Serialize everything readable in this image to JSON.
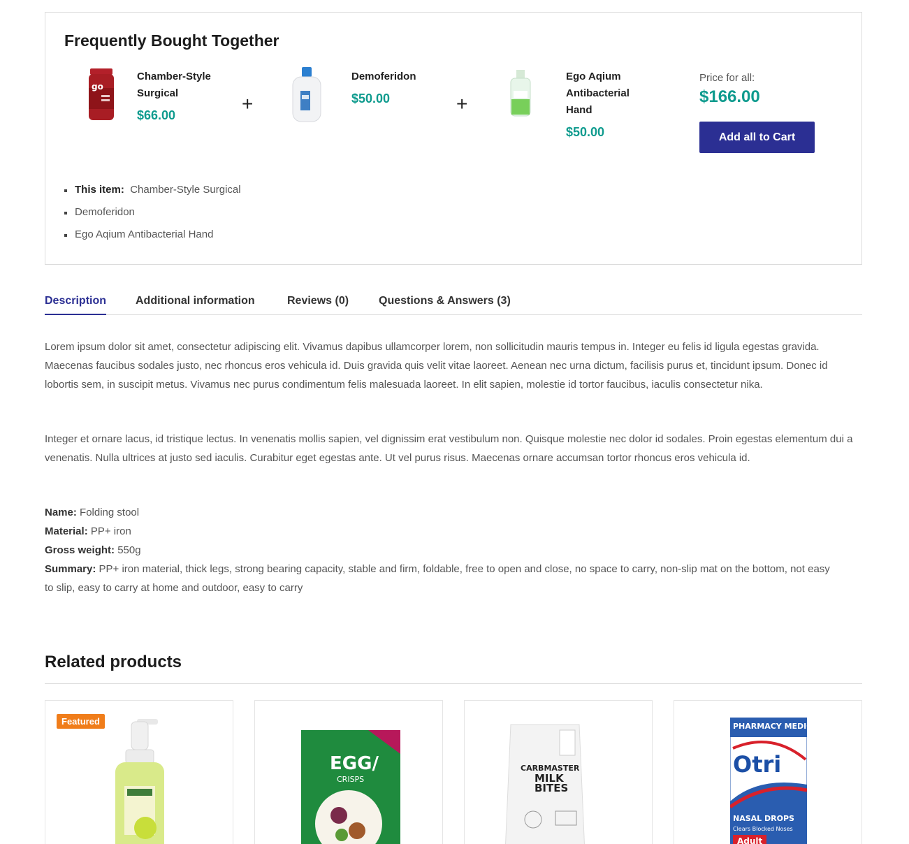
{
  "fbt": {
    "title": "Frequently Bought Together",
    "items": [
      {
        "name": "Chamber-Style Surgical",
        "price": "$66.00",
        "image_icon": "gummy-jar-icon"
      },
      {
        "name": "Demoferidon",
        "price": "$50.00",
        "image_icon": "lotion-bottle-icon"
      },
      {
        "name": "Ego Aqium Antibacterial Hand",
        "price": "$50.00",
        "image_icon": "sanitizer-bottle-icon"
      }
    ],
    "plus_symbol": "+",
    "price_for_all_label": "Price for all:",
    "price_for_all": "$166.00",
    "add_all_label": "Add all to Cart",
    "list_prefix": "This item:",
    "list": [
      "Chamber-Style Surgical",
      "Demoferidon",
      "Ego Aqium Antibacterial Hand"
    ]
  },
  "tabs": [
    {
      "label": "Description",
      "active": true
    },
    {
      "label": "Additional information",
      "active": false
    },
    {
      "label": "Reviews (0)",
      "active": false
    },
    {
      "label": "Questions & Answers (3)",
      "active": false
    }
  ],
  "description": {
    "paragraph1": "Lorem ipsum dolor sit amet, consectetur adipiscing elit. Vivamus dapibus ullamcorper lorem, non sollicitudin mauris tempus in. Integer eu felis id ligula egestas gravida. Maecenas faucibus sodales justo, nec rhoncus eros vehicula id. Duis gravida quis velit vitae laoreet. Aenean nec urna dictum, facilisis purus et, tincidunt ipsum. Donec id lobortis sem, in suscipit metus. Vivamus nec purus condimentum felis malesuada laoreet. In elit sapien, molestie id tortor faucibus, iaculis consectetur nika.",
    "paragraph2": "Integer et ornare lacus, id tristique lectus. In venenatis mollis sapien, vel dignissim erat vestibulum non. Quisque molestie nec dolor id sodales. Proin egestas elementum dui a venenatis. Nulla ultrices at justo sed iaculis. Curabitur eget egestas ante. Ut vel purus risus. Maecenas ornare accumsan tortor rhoncus eros vehicula id.",
    "specs": [
      {
        "label": "Name:",
        "value": "Folding stool"
      },
      {
        "label": "Material:",
        "value": "PP+ iron"
      },
      {
        "label": "Gross weight:",
        "value": "550g"
      },
      {
        "label": "Summary:",
        "value": "PP+ iron material, thick legs, strong bearing capacity, stable and firm, foldable, free to open and close, no space to carry, non-slip mat on the bottom, not easy to slip, easy to carry at home and outdoor, easy to carry"
      }
    ]
  },
  "related": {
    "title": "Related products",
    "badge": "Featured",
    "products": [
      {
        "image_icon": "soap-pump-icon"
      },
      {
        "image_icon": "crisps-bag-icon",
        "pack_text": "EGG/",
        "pack_sub": "CRISPS"
      },
      {
        "image_icon": "milk-bites-bag-icon",
        "pack_text1": "CARBMASTER",
        "pack_text2": "MILK",
        "pack_text3": "BITES"
      },
      {
        "image_icon": "nasal-drops-box-icon",
        "pack_top": "PHARMACY MEDICINE",
        "pack_brand": "Otri",
        "pack_line": "NASAL DROPS",
        "pack_sub": "Clears Blocked Noses",
        "pack_badge": "Adult"
      }
    ]
  },
  "colors": {
    "accent": "#2b2f93",
    "price": "#0f9b8e",
    "badge": "#f07d1a"
  }
}
